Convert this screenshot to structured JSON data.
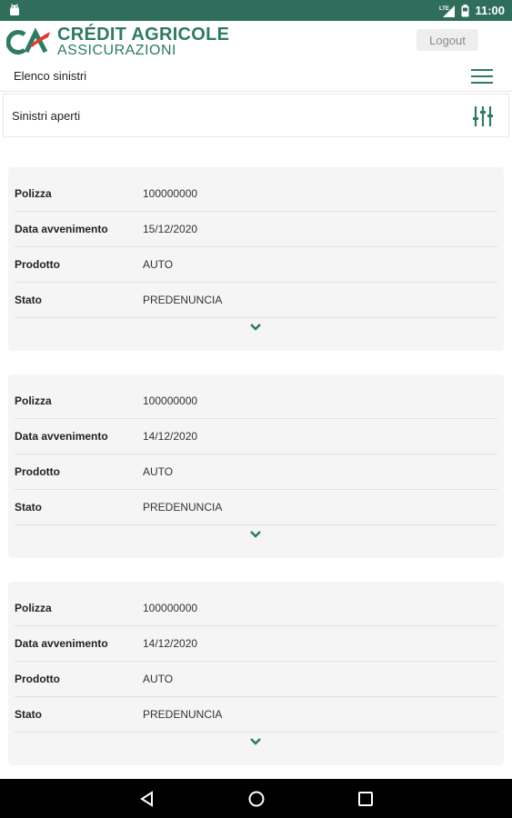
{
  "status": {
    "time": "11:00",
    "signal_label": "LTE"
  },
  "brand": {
    "line1": "CRÉDIT AGRICOLE",
    "line2": "ASSICURAZIONI",
    "color": "#2f7a63"
  },
  "header": {
    "logout_label": "Logout"
  },
  "nav": {
    "title": "Elenco sinistri"
  },
  "section": {
    "title": "Sinistri aperti"
  },
  "claims": [
    {
      "polizza_label": "Polizza",
      "polizza": "100000000",
      "data_label": "Data avvenimento",
      "data": "15/12/2020",
      "prodotto_label": "Prodotto",
      "prodotto": "AUTO",
      "stato_label": "Stato",
      "stato": "PREDENUNCIA"
    },
    {
      "polizza_label": "Polizza",
      "polizza": "100000000",
      "data_label": "Data avvenimento",
      "data": "14/12/2020",
      "prodotto_label": "Prodotto",
      "prodotto": "AUTO",
      "stato_label": "Stato",
      "stato": "PREDENUNCIA"
    },
    {
      "polizza_label": "Polizza",
      "polizza": "100000000",
      "data_label": "Data avvenimento",
      "data": "14/12/2020",
      "prodotto_label": "Prodotto",
      "prodotto": "AUTO",
      "stato_label": "Stato",
      "stato": "PREDENUNCIA"
    }
  ],
  "colors": {
    "statusbar": "#2f6e5b",
    "accent": "#2f7a63",
    "card_bg": "#f5f5f5"
  }
}
